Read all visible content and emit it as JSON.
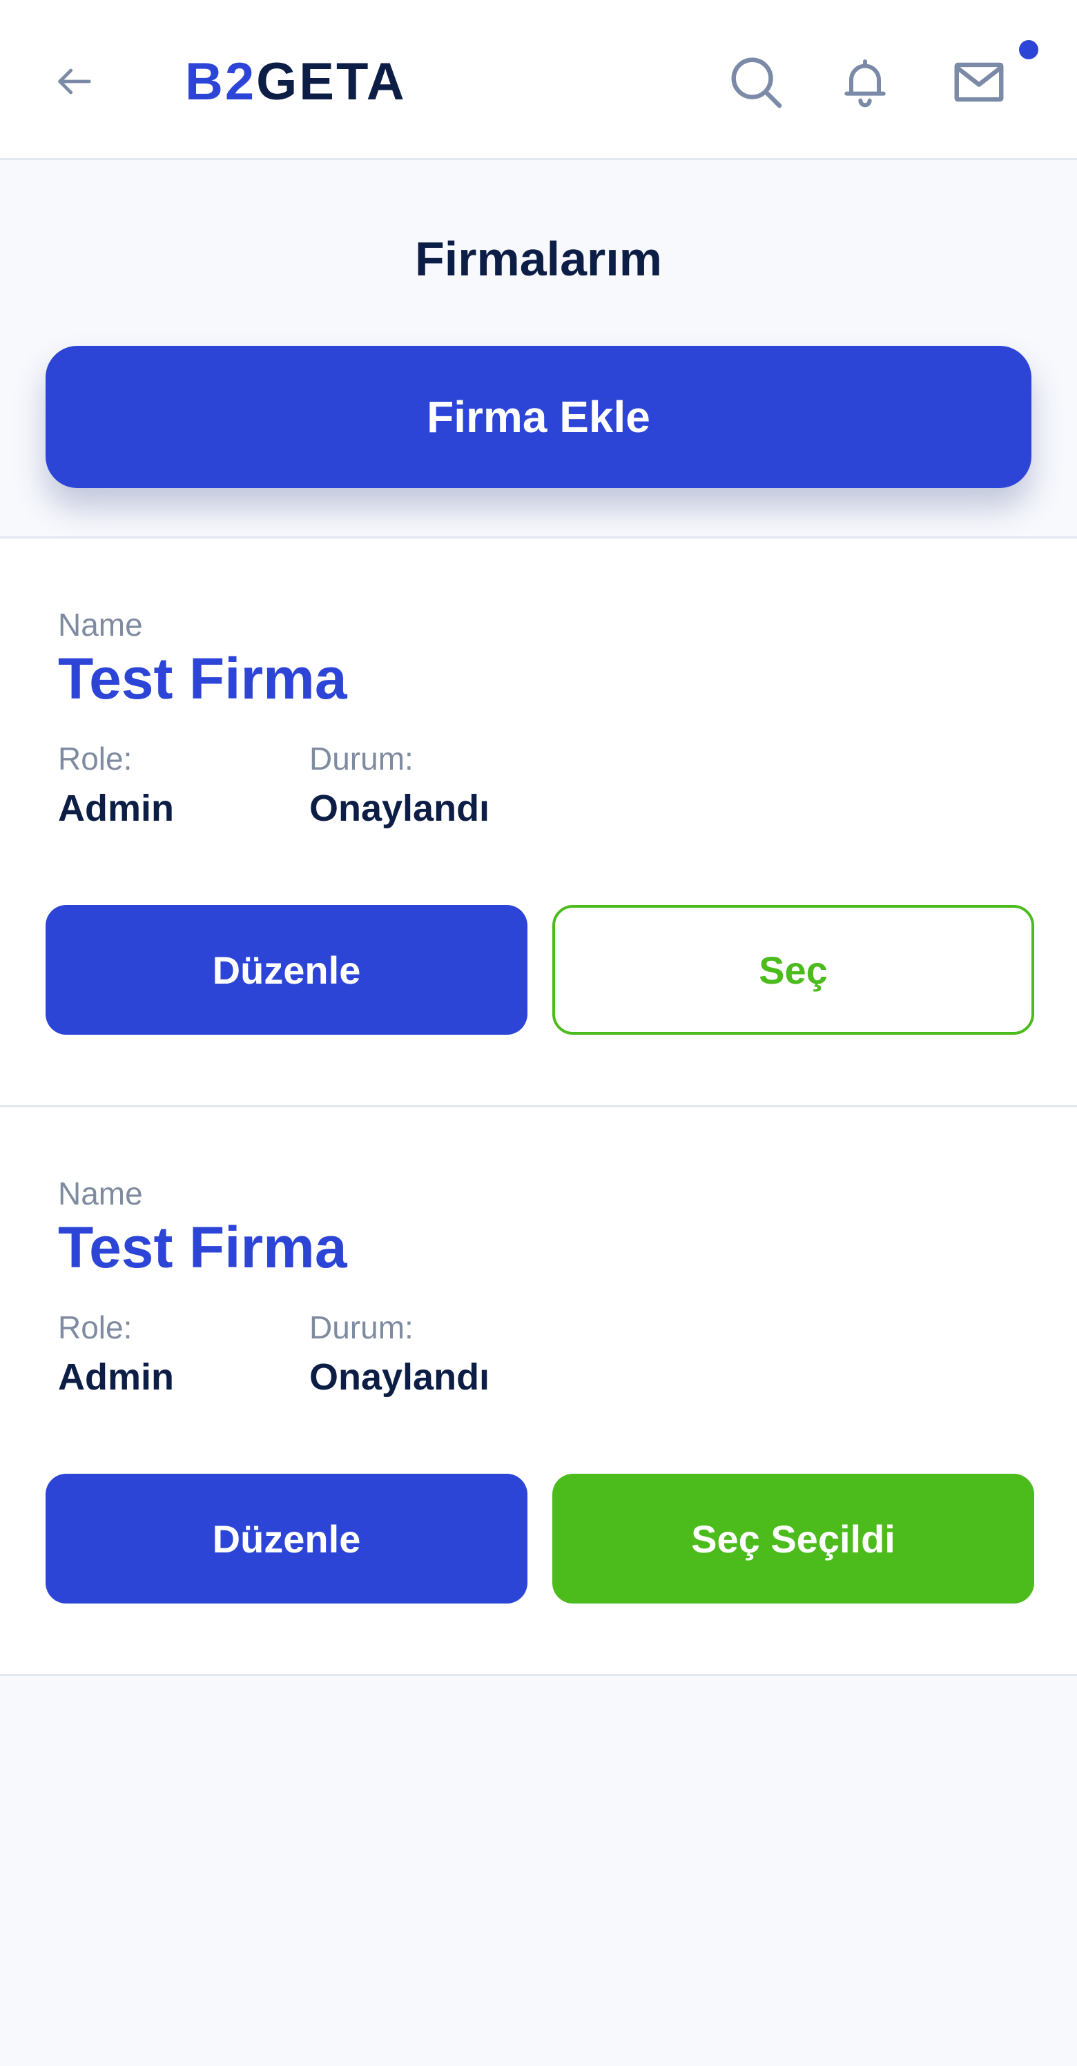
{
  "header": {
    "logo": {
      "part1": "B2",
      "part2": "GETA"
    },
    "icons": [
      "back-arrow-icon",
      "search-icon",
      "bell-icon",
      "mail-icon"
    ],
    "has_unread_notification": true
  },
  "page": {
    "title": "Firmalarım",
    "add_button_label": "Firma Ekle"
  },
  "companies": [
    {
      "name_label": "Name",
      "name": "Test Firma",
      "role_label": "Role:",
      "role": "Admin",
      "status_label": "Durum:",
      "status": "Onaylandı",
      "edit_label": "Düzenle",
      "select_label": "Seç",
      "selected": false
    },
    {
      "name_label": "Name",
      "name": "Test Firma",
      "role_label": "Role:",
      "role": "Admin",
      "status_label": "Durum:",
      "status": "Onaylandı",
      "edit_label": "Düzenle",
      "select_label": "Seç Seçildi",
      "selected": true
    }
  ],
  "colors": {
    "primary": "#2c45d6",
    "success": "#4cbb1c",
    "text_dark": "#0d1e46",
    "text_muted": "#7f8ba0",
    "background": "#f8f9fd",
    "divider": "#e3e8f0"
  }
}
